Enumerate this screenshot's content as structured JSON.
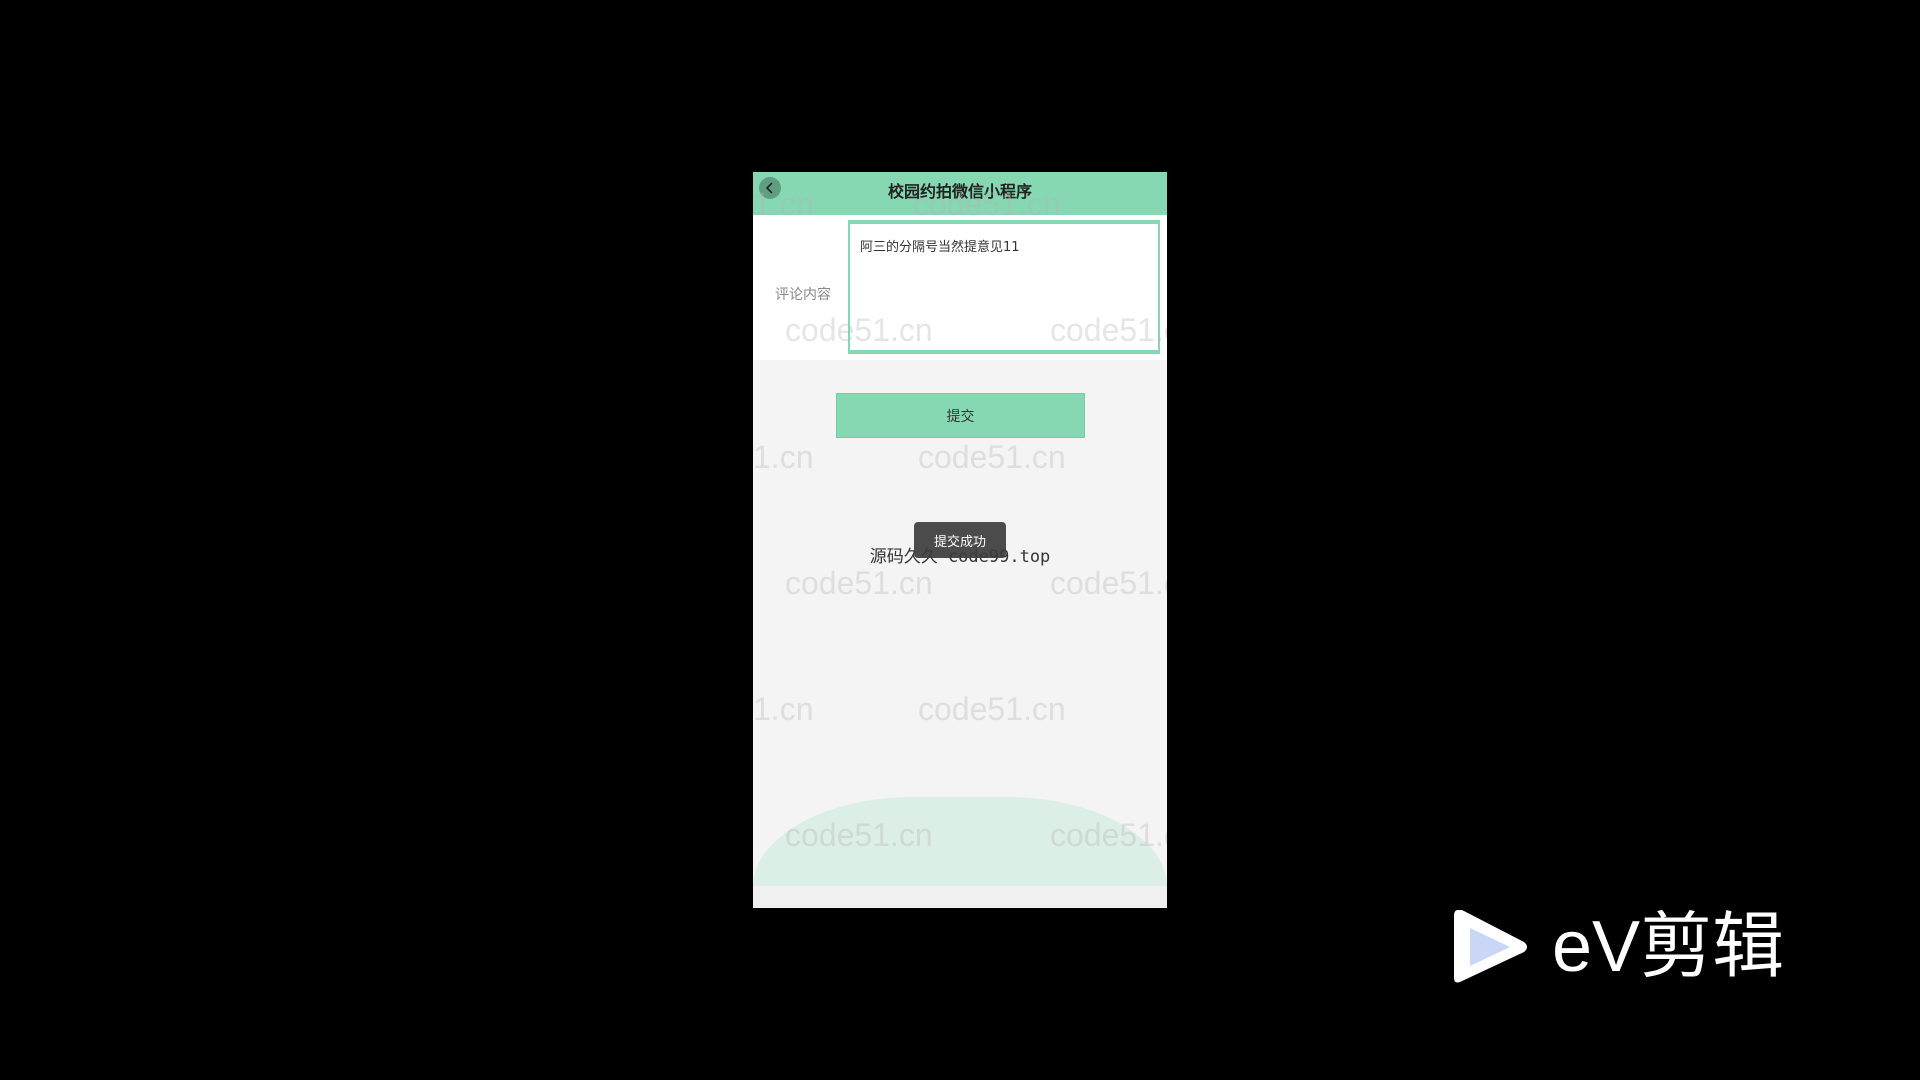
{
  "navbar": {
    "title": "校园约拍微信小程序",
    "back_icon": "chevron-left-icon"
  },
  "form": {
    "comment_label": "评论内容",
    "comment_value": "阿三的分隔号当然提意见11"
  },
  "submit_label": "提交",
  "toast": "提交成功",
  "source_note": "源码久久 code99.top",
  "watermark": "code51.cn",
  "watermark_partial": "1.cn",
  "logo": {
    "text": "eV剪辑",
    "icon": "play-icon"
  },
  "colors": {
    "accent": "#86d8b3",
    "background": "#000000"
  }
}
